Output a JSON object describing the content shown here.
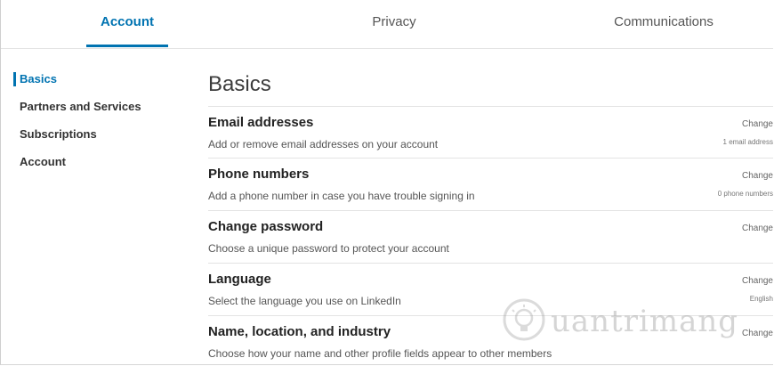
{
  "tabs": [
    {
      "label": "Account",
      "active": true
    },
    {
      "label": "Privacy",
      "active": false
    },
    {
      "label": "Communications",
      "active": false
    }
  ],
  "sidebar": {
    "items": [
      {
        "label": "Basics",
        "active": true
      },
      {
        "label": "Partners and Services",
        "active": false
      },
      {
        "label": "Subscriptions",
        "active": false
      },
      {
        "label": "Account",
        "active": false
      }
    ]
  },
  "main": {
    "title": "Basics",
    "sections": [
      {
        "title": "Email addresses",
        "description": "Add or remove email addresses on your account",
        "action": "Change",
        "meta": "1 email address"
      },
      {
        "title": "Phone numbers",
        "description": "Add a phone number in case you have trouble signing in",
        "action": "Change",
        "meta": "0 phone numbers"
      },
      {
        "title": "Change password",
        "description": "Choose a unique password to protect your account",
        "action": "Change",
        "meta": ""
      },
      {
        "title": "Language",
        "description": "Select the language you use on LinkedIn",
        "action": "Change",
        "meta": "English"
      },
      {
        "title": "Name, location, and industry",
        "description": "Choose how your name and other profile fields appear to other members",
        "action": "Change",
        "meta": ""
      }
    ]
  },
  "watermark": {
    "text": "uantrimang",
    "icon": "lightbulb-logo-icon"
  },
  "colors": {
    "accent": "#0073b1",
    "divider": "#e3e3e3",
    "text": "#333333"
  }
}
